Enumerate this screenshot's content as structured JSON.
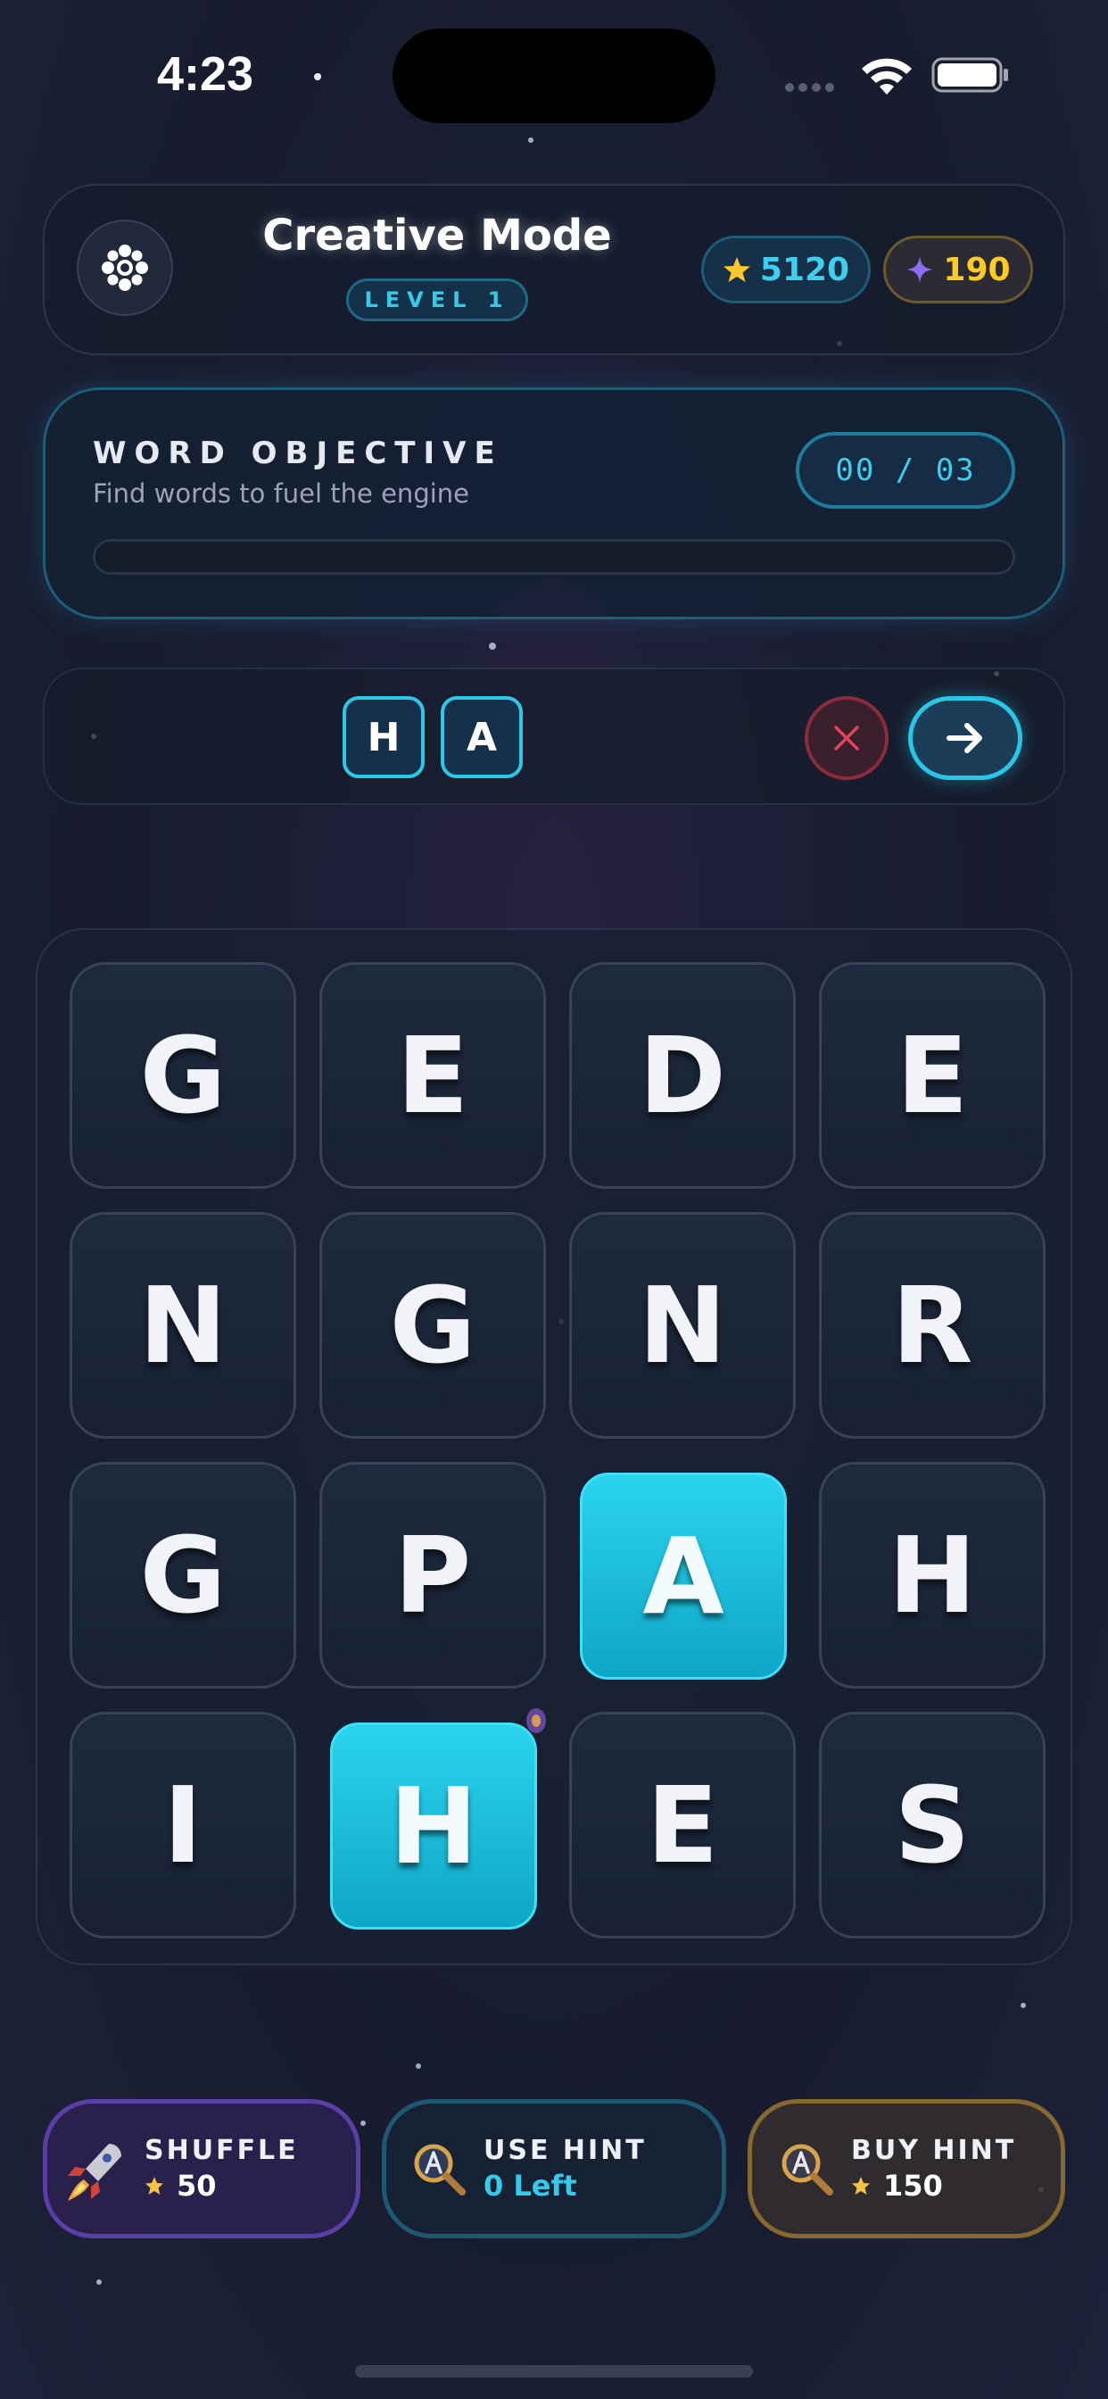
{
  "status_bar": {
    "time": "4:23"
  },
  "header": {
    "title": "Creative Mode",
    "level_label": "LEVEL 1",
    "stars": "5120",
    "gems": "190",
    "icons": {
      "settings": "gear-icon",
      "stars": "star-icon",
      "gems": "sparkle-icon"
    }
  },
  "objective": {
    "title": "WORD OBJECTIVE",
    "subtitle": "Find words to fuel the engine",
    "count": "00 / 03",
    "progress": 0
  },
  "current_word": {
    "letters": [
      "H",
      "A"
    ],
    "icons": {
      "clear": "close-icon",
      "submit": "arrow-right-icon"
    }
  },
  "grid": {
    "rows": [
      [
        "G",
        "E",
        "D",
        "E"
      ],
      [
        "N",
        "G",
        "N",
        "R"
      ],
      [
        "G",
        "P",
        "A",
        "H"
      ],
      [
        "I",
        "H",
        "E",
        "S"
      ]
    ],
    "selected": [
      [
        2,
        2
      ],
      [
        3,
        1
      ]
    ]
  },
  "actions": {
    "shuffle": {
      "label": "SHUFFLE",
      "cost": "50",
      "icon": "rocket-icon"
    },
    "use_hint": {
      "label": "USE HINT",
      "value": "0 Left",
      "icon": "magnifier-icon"
    },
    "buy_hint": {
      "label": "BUY HINT",
      "cost": "150",
      "icon": "magnifier-icon"
    }
  },
  "colors": {
    "accent": "#33cbe9",
    "gold": "#ffcb22",
    "danger": "#e0455a",
    "purple": "#5b3fa8"
  }
}
